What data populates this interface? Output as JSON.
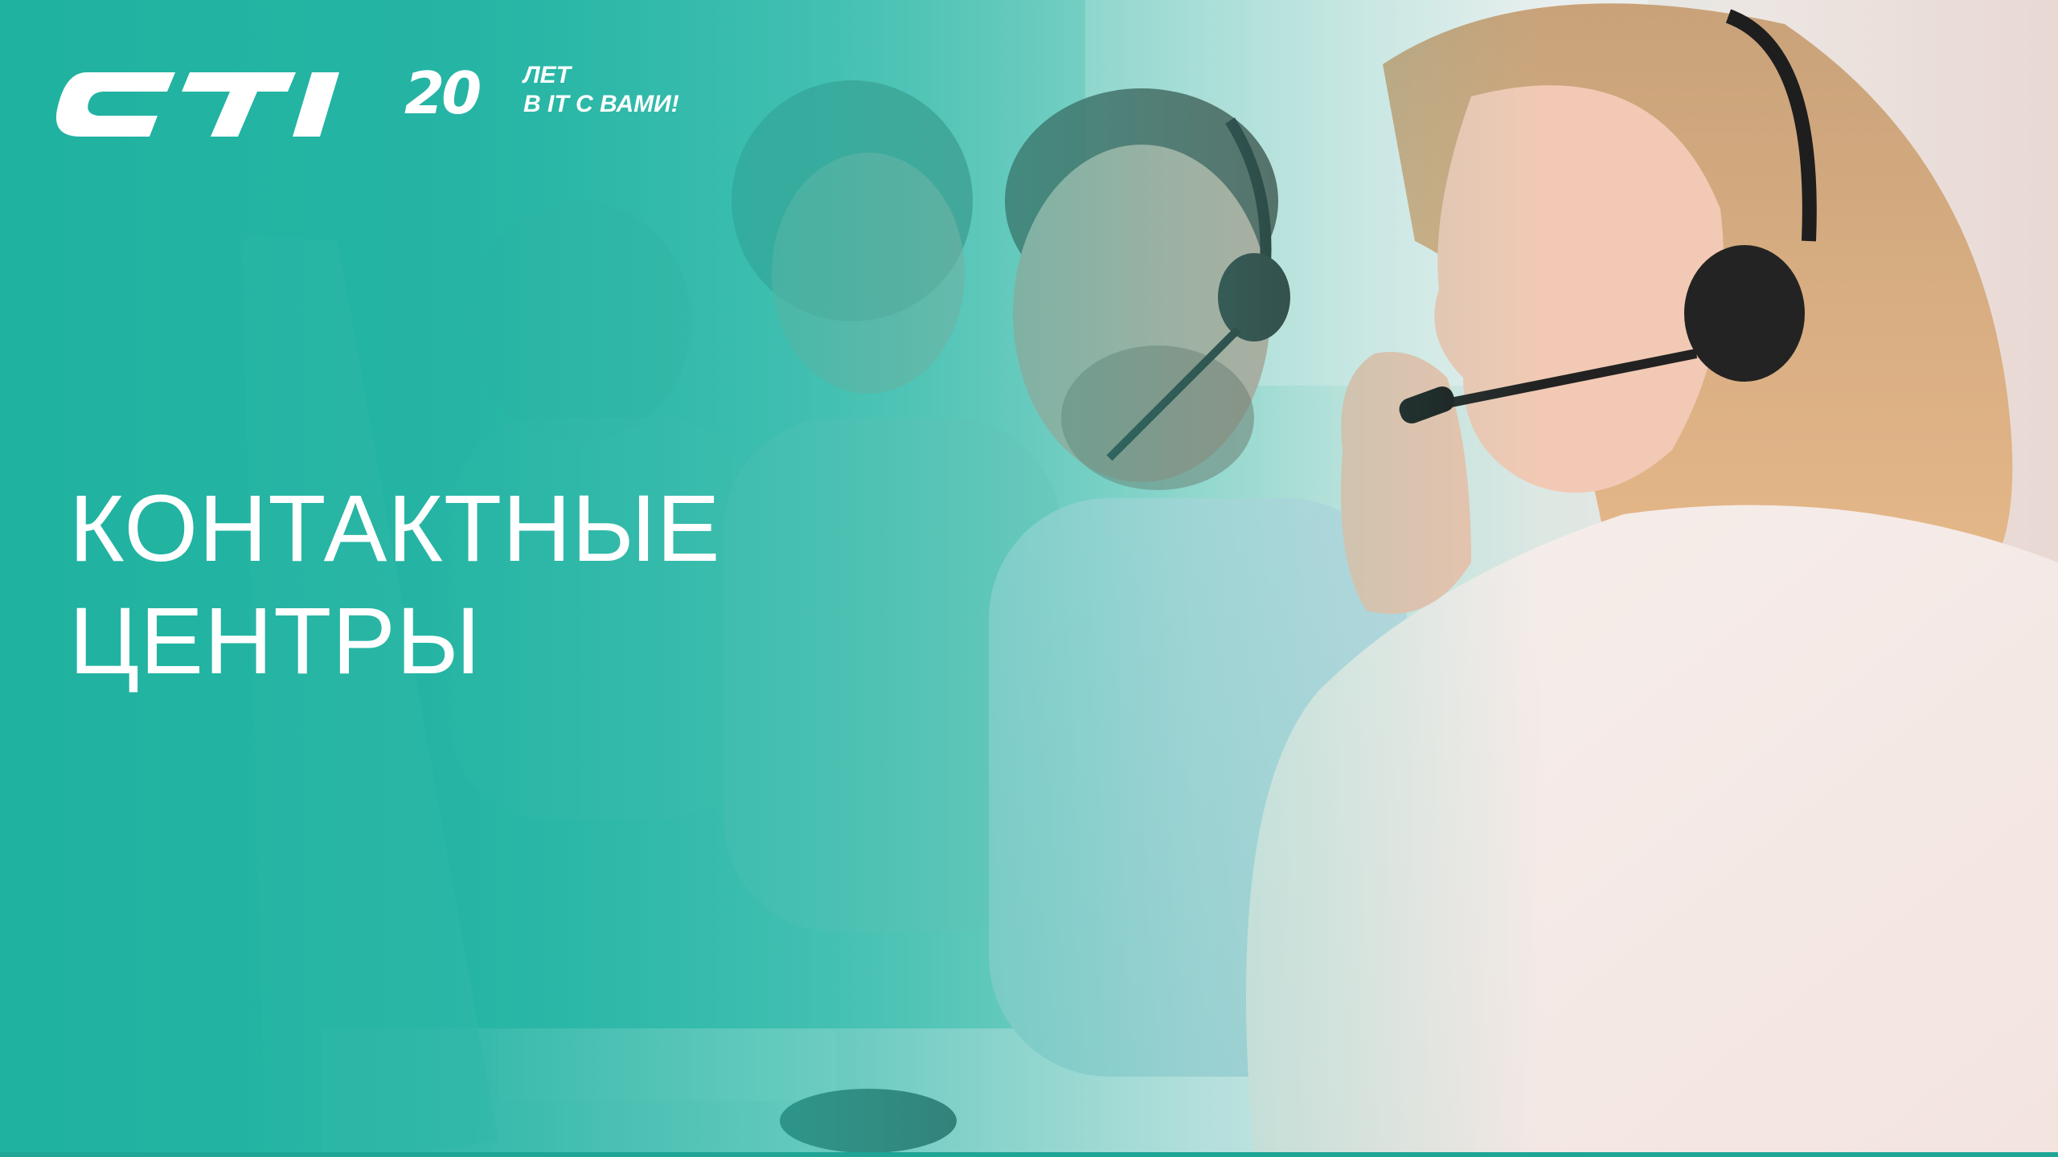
{
  "brand": {
    "logo_text": "CTI",
    "years": "20",
    "years_word": "ЛЕТ",
    "tagline": "В IT С ВАМИ!"
  },
  "title": {
    "line1": "КОНТАКТНЫЕ",
    "line2": "ЦЕНТРЫ"
  },
  "colors": {
    "accent": "#2bb9a9",
    "text": "#ffffff"
  },
  "background_image": "call-center-operators-with-headsets-photo"
}
